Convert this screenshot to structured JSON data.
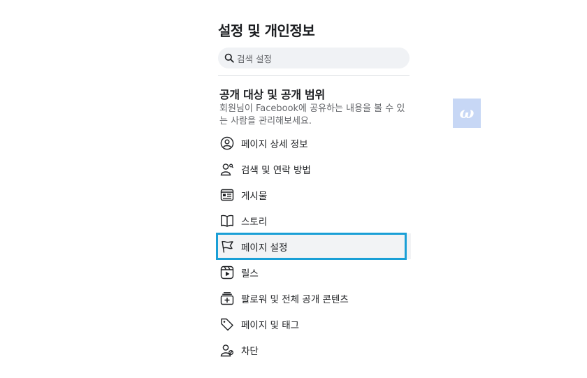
{
  "page": {
    "title": "설정 및 개인정보"
  },
  "search": {
    "placeholder": "검색 설정",
    "icon": "search-icon"
  },
  "section": {
    "title": "공개 대상 및 공개 범위",
    "description": "회원님이 Facebook에 공유하는 내용을 볼 수 있는 사람을 관리해보세요."
  },
  "menu": {
    "items": [
      {
        "label": "페이지 상세 정보",
        "icon": "profile-circle-icon"
      },
      {
        "label": "검색 및 연락 방법",
        "icon": "person-search-icon"
      },
      {
        "label": "게시물",
        "icon": "post-card-icon"
      },
      {
        "label": "스토리",
        "icon": "book-icon"
      },
      {
        "label": "페이지 설정",
        "icon": "flag-icon",
        "selected": true
      },
      {
        "label": "릴스",
        "icon": "reels-icon"
      },
      {
        "label": "팔로워 및 전체 공개 콘텐츠",
        "icon": "plus-stack-icon"
      },
      {
        "label": "페이지 및 태그",
        "icon": "tag-icon"
      },
      {
        "label": "차단",
        "icon": "person-block-icon"
      }
    ]
  },
  "badge": {
    "glyph": "ω"
  },
  "colors": {
    "highlight_border": "#1a9fd6",
    "secondary_text": "#65676b",
    "search_bg": "#f0f2f5",
    "badge_bg": "#c7d7f5"
  }
}
